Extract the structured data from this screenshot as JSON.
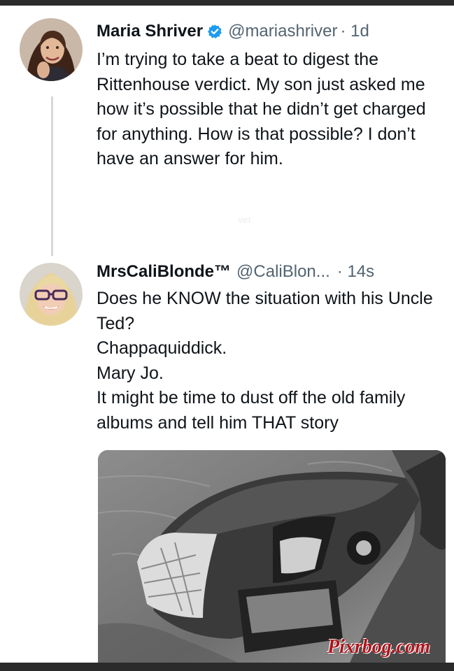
{
  "tweets": [
    {
      "name": "Maria Shriver",
      "handle": "@mariashriver",
      "time": "· 1d",
      "verified_icon": "verified-badge-icon",
      "lines": [
        "I’m trying to take a beat to digest the Rittenhouse verdict. My son just asked me how it’s possible that he didn’t get charged for anything. How is that possible? I don’t have an answer for him."
      ]
    },
    {
      "name": "MrsCaliBlonde™",
      "handle": "@CaliBlon...",
      "time": "· 14s",
      "lines": [
        "Does he KNOW the situation with his Uncle Ted?",
        "Chappaquiddick.",
        "Mary Jo.",
        "It might be time to dust off the old family albums and tell him THAT story"
      ]
    }
  ],
  "faint_text": "ver",
  "media": {
    "description_icon": "car-in-water-photo"
  },
  "watermark": "Pixrbog.com",
  "colors": {
    "text": "#0f1419",
    "secondary": "#536471",
    "verified": "#1d9bf0",
    "thread_line": "#d4d8dc",
    "watermark": "#b0141c"
  }
}
